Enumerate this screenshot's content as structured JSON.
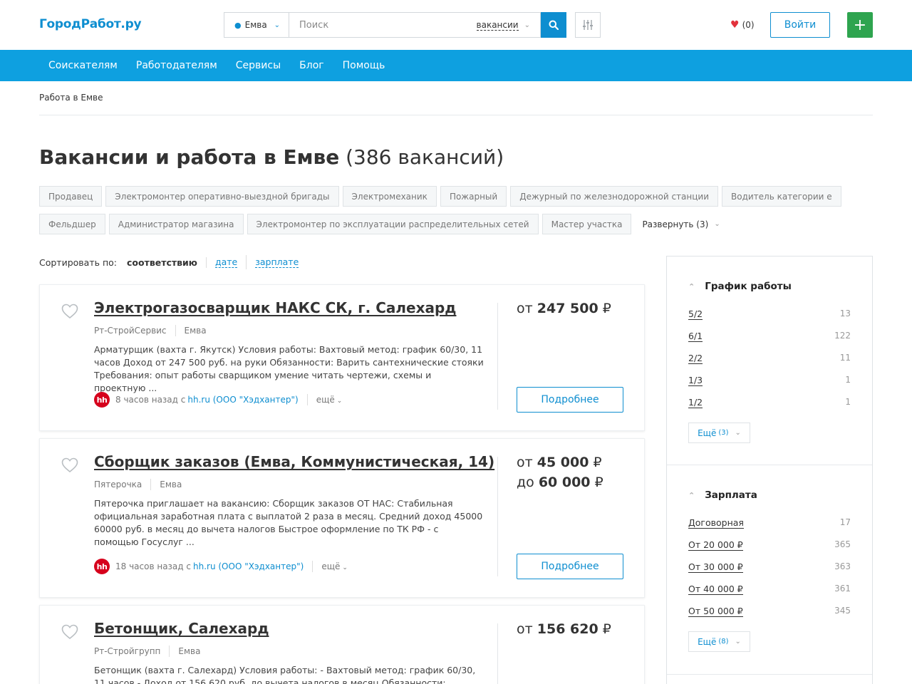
{
  "header": {
    "logo": "ГородРабот.ру",
    "city": "Емва",
    "search_placeholder": "Поиск",
    "search_type": "вакансии",
    "favorites_count": "(0)",
    "login_label": "Войти",
    "add_label": "+"
  },
  "nav": [
    "Соискателям",
    "Работодателям",
    "Сервисы",
    "Блог",
    "Помощь"
  ],
  "breadcrumb": "Работа в Емве",
  "page": {
    "title": "Вакансии и работа в Емве",
    "count": "(386 вакансий)"
  },
  "tags": [
    "Продавец",
    "Электромонтер оперативно-выездной бригады",
    "Электромеханик",
    "Пожарный",
    "Дежурный по железнодорожной станции",
    "Водитель категории е",
    "Фельдшер",
    "Администратор магазина",
    "Электромонтер по эксплуатации распределительных сетей",
    "Мастер участка"
  ],
  "tags_expand": "Развернуть (3)",
  "sort": {
    "label": "Сортировать по:",
    "active": "соответствию",
    "options": [
      "дате",
      "зарплате"
    ]
  },
  "vacancies": [
    {
      "title": "Электрогазосварщик НАКС СК, г. Салехард",
      "company": "Рт-СтройСервис",
      "city": "Емва",
      "description": "Арматурщик (вахта г. Якутск) Условия работы: Вахтовый метод: график 60/30, 11 часов Доход от 247 500 руб. на руки Обязанности: Варить сантехнические стояки Требования: опыт работы сварщиком умение читать чертежи, схемы и проектную ...",
      "time": "8 часов назад с",
      "source": "hh.ru (ООО \"Хэдхантер\")",
      "more": "ещё",
      "salary_from_prefix": "от",
      "salary_from": "247 500",
      "currency": "₽",
      "button": "Подробнее"
    },
    {
      "title": "Сборщик заказов (Емва, Коммунистическая, 14)",
      "company": "Пятерочка",
      "city": "Емва",
      "description": "Пятерочка приглашает на вакансию: Сборщик заказов ОТ НАС: Стабильная официальная заработная плата с выплатой 2 раза в месяц. Средний доход 45000 60000 руб. в месяц до вычета налогов Быстрое оформление по ТК РФ - с помощью Госуслуг ...",
      "time": "18 часов назад с",
      "source": "hh.ru (ООО \"Хэдхантер\")",
      "more": "ещё",
      "salary_from_prefix": "от",
      "salary_from": "45 000",
      "salary_to_prefix": "до",
      "salary_to": "60 000",
      "currency": "₽",
      "button": "Подробнее"
    },
    {
      "title": "Бетонщик, Салехард",
      "company": "Рт-Стройгрупп",
      "city": "Емва",
      "description": "Бетонщик (вахта г. Салехард) Условия работы: - Вахтовый метод: график 60/30, 11 часов - Доход от 156 620 руб. до вычета налогов в месяц Обязанности: выполнение",
      "salary_from_prefix": "от",
      "salary_from": "156 620",
      "currency": "₽"
    }
  ],
  "filters": {
    "schedule": {
      "title": "График работы",
      "items": [
        {
          "label": "5/2",
          "count": "13"
        },
        {
          "label": "6/1",
          "count": "122"
        },
        {
          "label": "2/2",
          "count": "11"
        },
        {
          "label": "1/3",
          "count": "1"
        },
        {
          "label": "1/2",
          "count": "1"
        }
      ],
      "more_label": "Ещё",
      "more_count": "(3)"
    },
    "salary": {
      "title": "Зарплата",
      "items": [
        {
          "label": "Договорная",
          "count": "17"
        },
        {
          "label": "От 20 000 ₽",
          "count": "365"
        },
        {
          "label": "От 30 000 ₽",
          "count": "363"
        },
        {
          "label": "От 40 000 ₽",
          "count": "361"
        },
        {
          "label": "От 50 000 ₽",
          "count": "345"
        }
      ],
      "more_label": "Ещё",
      "more_count": "(8)"
    }
  },
  "colors": {
    "brand": "#0e8ed0",
    "nav": "#0ea0e0",
    "add": "#2ea44f",
    "heart": "#e2323c",
    "hh": "#d6001c"
  }
}
